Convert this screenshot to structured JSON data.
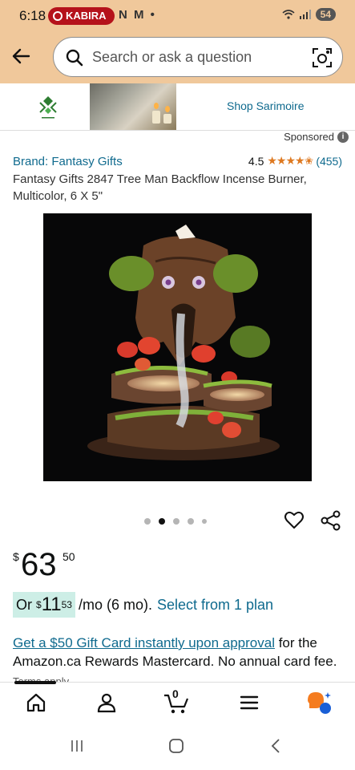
{
  "status": {
    "time": "6:18",
    "pill_label": "KABIRA",
    "notif_icons": "N M •",
    "battery": "54"
  },
  "search": {
    "placeholder": "Search or ask a question"
  },
  "banner": {
    "shop_label": "Shop Sarimoire",
    "sponsored": "Sponsored"
  },
  "product": {
    "brand": "Brand: Fantasy Gifts",
    "rating": "4.5",
    "stars": "★★★★✬",
    "rating_count": "(455)",
    "title": "Fantasy Gifts 2847 Tree Man Backflow Incense Burner, Multicolor, 6 X 5\"",
    "image_pages": 5,
    "current_image_page": 2
  },
  "price": {
    "symbol": "$",
    "whole": "63",
    "fraction": "50"
  },
  "plan": {
    "or": "Or",
    "symbol": "$",
    "whole": "11",
    "fraction": "53",
    "per": "/mo (6 mo).",
    "select": "Select from 1 plan"
  },
  "promo": {
    "link": "Get a $50 Gift Card instantly upon approval",
    "text": " for the Amazon.ca Rewards Mastercard. No annual card fee.",
    "terms": " Terms apply."
  },
  "nav": {
    "cart_count": "0"
  },
  "colors": {
    "header": "#f0c89b",
    "link": "#0f6a8e",
    "star": "#de7921",
    "plan_highlight": "#cdeee6"
  }
}
